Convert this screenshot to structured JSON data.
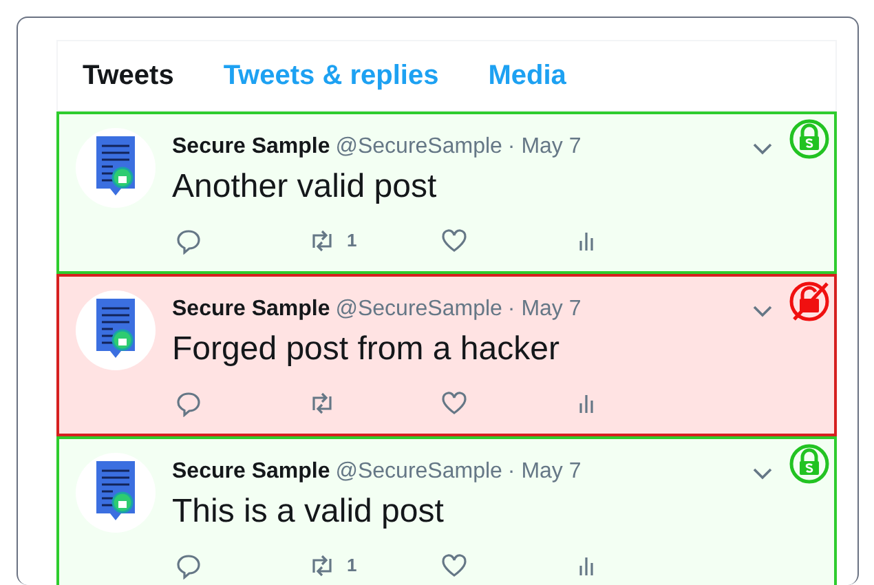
{
  "tabs": [
    {
      "label": "Tweets",
      "selected": true
    },
    {
      "label": "Tweets & replies",
      "selected": false
    },
    {
      "label": "Media",
      "selected": false
    }
  ],
  "tweets": [
    {
      "name": "Secure Sample",
      "handle": "@SecureSample",
      "date": "· May 7",
      "text": "Another valid post",
      "retweets": "1",
      "verified": true
    },
    {
      "name": "Secure Sample",
      "handle": "@SecureSample",
      "date": "· May 7",
      "text": "Forged post from a hacker",
      "verified": false
    },
    {
      "name": "Secure Sample",
      "handle": "@SecureSample",
      "date": "· May 7",
      "text": "This is a valid post",
      "retweets": "1",
      "verified": true
    }
  ]
}
